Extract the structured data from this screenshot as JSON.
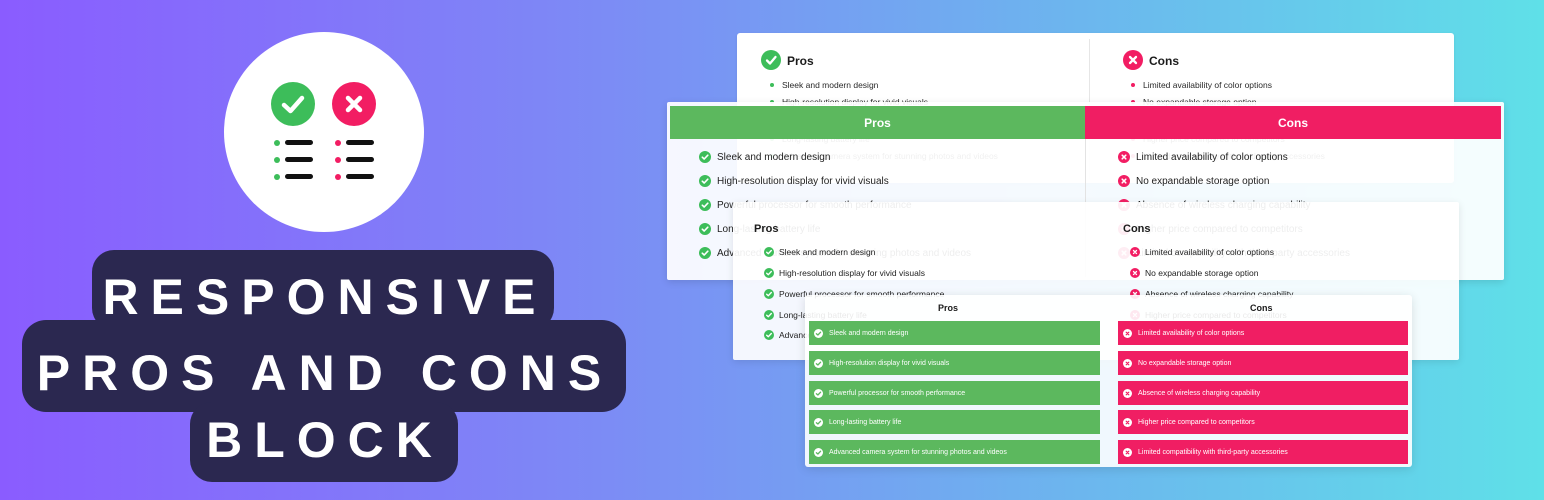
{
  "title": {
    "line1": "RESPONSIVE",
    "line2": "PROS AND CONS",
    "line3": "BLOCK"
  },
  "logo": {
    "icons": [
      "check-icon",
      "cross-icon"
    ],
    "colors": {
      "pro": "#3dbd5a",
      "con": "#f21d63"
    }
  },
  "pros": {
    "label": "Pros",
    "items": [
      "Sleek and modern design",
      "High-resolution display for vivid visuals",
      "Powerful processor for smooth performance",
      "Long-lasting battery life",
      "Advanced camera system for stunning photos and videos"
    ]
  },
  "cons": {
    "label": "Cons",
    "items": [
      "Limited availability of color options",
      "No expandable storage option",
      "Absence of wireless charging capability",
      "Higher price compared to competitors",
      "Limited compatibility with third-party accessories"
    ]
  }
}
